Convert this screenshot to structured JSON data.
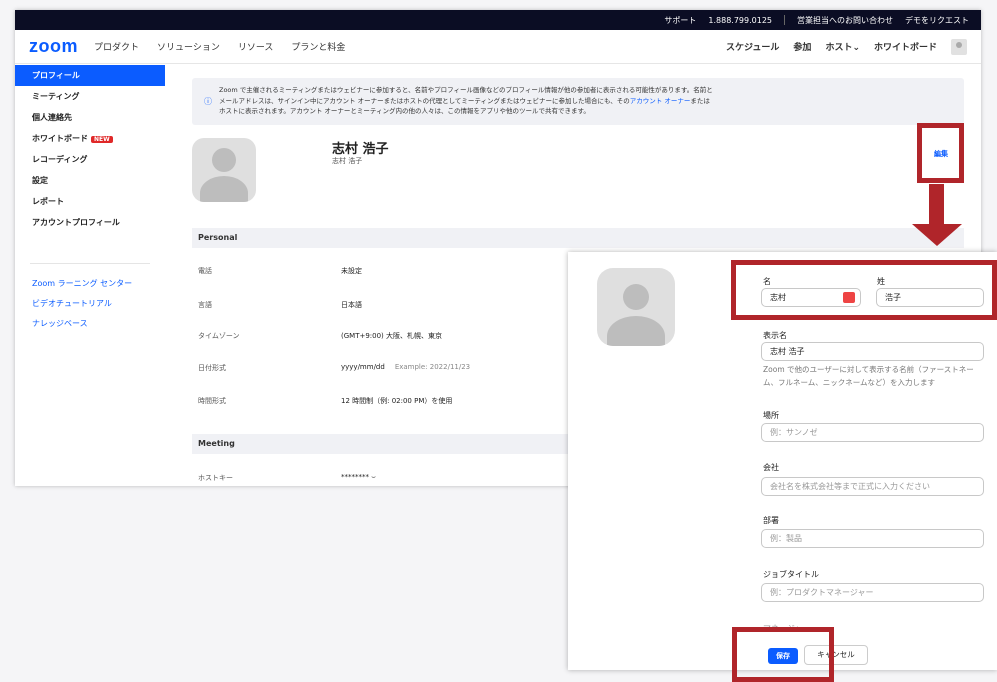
{
  "topbar": {
    "support": "サポート",
    "phone": "1.888.799.0125",
    "contact_sales": "営業担当へのお問い合わせ",
    "demo": "デモをリクエスト"
  },
  "navbar": {
    "logo": "zoom",
    "items": [
      "プロダクト",
      "ソリューション",
      "リソース",
      "プランと料金"
    ],
    "right": [
      "スケジュール",
      "参加",
      "ホスト⌄",
      "ホワイトボード"
    ]
  },
  "sidebar": {
    "items": [
      "プロフィール",
      "ミーティング",
      "個人連絡先",
      "ホワイトボード",
      "レコーディング",
      "設定",
      "レポート",
      "アカウントプロフィール"
    ],
    "new_badge": "NEW",
    "links": [
      "Zoom ラーニング センター",
      "ビデオチュートリアル",
      "ナレッジベース"
    ]
  },
  "notice": {
    "line1": "Zoom で主催されるミーティングまたはウェビナーに参加すると、名前やプロフィール画像などのプロフィール情報が他の参加者に表示される可能性があります。名前と",
    "line2a": "メールアドレスは、サインイン中にアカウント オーナーまたはホストの代理としてミーティングまたはウェビナーに参加した場合にも、その",
    "link": "アカウント オーナー",
    "line2b": "または",
    "line3": "ホストに表示されます。アカウント オーナーとミーティング内の他の人々は、この情報をアプリや他のツールで共有できます。"
  },
  "profile": {
    "name": "志村 浩子",
    "sub": "志村 浩子",
    "edit": "編集"
  },
  "personal": {
    "heading": "Personal",
    "rows": [
      {
        "label": "電話",
        "value": "未設定"
      },
      {
        "label": "言語",
        "value": "日本語"
      },
      {
        "label": "タイムゾーン",
        "value": "(GMT+9:00) 大阪、札幌、東京"
      },
      {
        "label": "日付形式",
        "value": "yyyy/mm/dd",
        "example": "Example: 2022/11/23"
      },
      {
        "label": "時間形式",
        "value": "12 時間制（例: 02:00 PM）を使用"
      }
    ]
  },
  "meeting": {
    "heading": "Meeting",
    "rows": [
      {
        "label": "ホストキー",
        "value": "********  ⌣"
      }
    ]
  },
  "form": {
    "first_name_label": "名",
    "first_name": "志村",
    "last_name_label": "姓",
    "last_name": "浩子",
    "display_label": "表示名",
    "display_value": "志村 浩子",
    "display_help": "Zoom で他のユーザーに対して表示する名前（ファーストネーム、フルネーム、ニックネームなど）を入力します",
    "location_label": "場所",
    "location_placeholder": "例：サンノゼ",
    "company_label": "会社",
    "company_placeholder": "会社名を株式会社等まで正式に入力ください",
    "dept_label": "部署",
    "dept_placeholder": "例：製品",
    "job_label": "ジョブタイトル",
    "job_placeholder": "例：プロダクトマネージャー",
    "manager_label": "マネージャー",
    "save": "保存",
    "cancel": "キャンセル"
  },
  "colors": {
    "zoom_blue": "#0b5cff",
    "highlight_red": "#b0252a",
    "topbar": "#0b0d24"
  }
}
